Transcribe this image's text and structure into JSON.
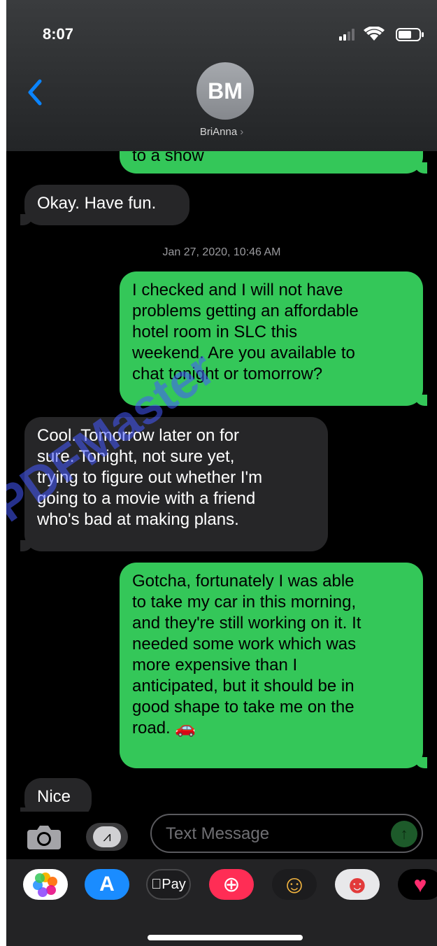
{
  "status_bar": {
    "time": "8:07"
  },
  "header": {
    "avatar_initials": "BM",
    "contact_name": "BriAnna",
    "chevron": "›",
    "back_icon": "chevron-left-icon"
  },
  "messages": [
    {
      "side": "sent",
      "text": "to a show"
    },
    {
      "side": "received",
      "text": "Okay. Have fun."
    },
    {
      "side": "sent",
      "text": "I checked and I will not have\nproblems getting an affordable\nhotel room in SLC this\nweekend. Are you available to\nchat tonight or tomorrow?"
    },
    {
      "side": "received",
      "text": "Cool. Tomorrow later on for\nsure. Tonight, not sure yet,\ntrying to figure out whether I'm\ngoing to a movie with a friend\nwho's bad at making plans."
    },
    {
      "side": "sent",
      "text": "Gotcha, fortunately I was able\nto take my car in this morning,\nand they're still working on it. It\nneeded some work which was\nmore expensive than I\nanticipated, but it should be in\ngood shape to take me on the\nroad. 🚗"
    },
    {
      "side": "received",
      "text": "Nice"
    }
  ],
  "timestamp": "Jan 27, 2020, 10:46 AM",
  "watermark": "PDFMaster",
  "input": {
    "placeholder": "Text Message"
  },
  "apps": [
    {
      "name": "photos-app-icon",
      "glyph": "✿",
      "color": "#ffffff"
    },
    {
      "name": "app-store-icon",
      "glyph": "A",
      "color": "#1a8cff"
    },
    {
      "name": "apple-pay-icon",
      "glyph": "Pay",
      "color": "#1c1c1e"
    },
    {
      "name": "search-images-icon",
      "glyph": "⊕",
      "color": "#ff2d55"
    },
    {
      "name": "memoji-icon",
      "glyph": "☺",
      "color": "#1c1c1e"
    },
    {
      "name": "memoji-stickers-icon",
      "glyph": "☻",
      "color": "#e8e8ea"
    },
    {
      "name": "digital-touch-icon",
      "glyph": "♥",
      "color": "#000000"
    }
  ],
  "colors": {
    "sent": "#34c759",
    "received": "#262628",
    "accent": "#0a84ff"
  }
}
